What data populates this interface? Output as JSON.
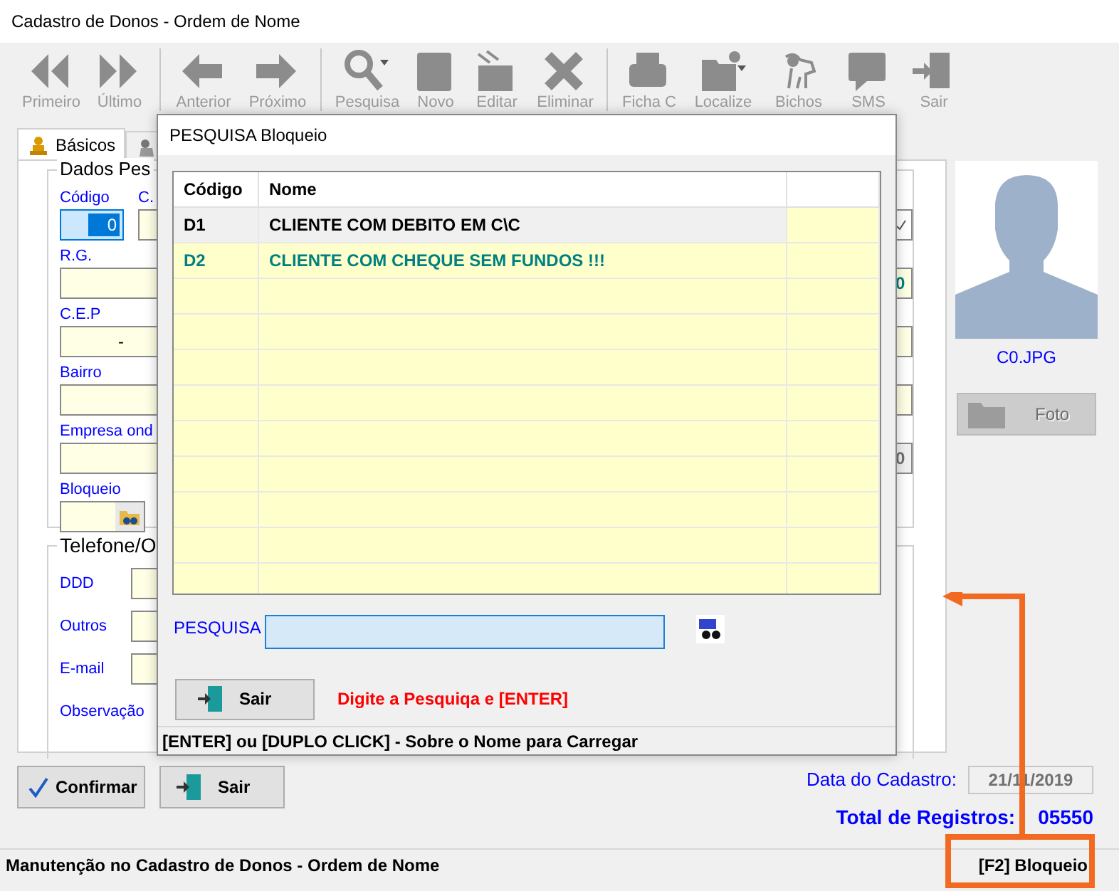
{
  "window": {
    "title": "Cadastro de Donos - Ordem de Nome"
  },
  "toolbar": [
    {
      "label": "Primeiro",
      "disabled": true
    },
    {
      "label": "Último",
      "disabled": true
    },
    {
      "label": "Anterior",
      "disabled": true
    },
    {
      "label": "Próximo",
      "disabled": true
    },
    {
      "label": "Pesquisa",
      "disabled": true
    },
    {
      "label": "Novo",
      "disabled": true
    },
    {
      "label": "Editar",
      "disabled": true
    },
    {
      "label": "Eliminar",
      "disabled": true
    },
    {
      "label": "Ficha C",
      "disabled": true
    },
    {
      "label": "Localize",
      "disabled": true
    },
    {
      "label": "Bichos",
      "disabled": true
    },
    {
      "label": "SMS",
      "disabled": true
    },
    {
      "label": "Sair",
      "disabled": true
    }
  ],
  "tabs": [
    {
      "label": "Básicos",
      "selected": true
    },
    {
      "selected": false
    }
  ],
  "form": {
    "group_1": "Dados Pes",
    "group_2": "Telefone/O",
    "fields": [
      {
        "label": "Código",
        "value": "0",
        "focused": true,
        "right": {
          "kind": "check"
        }
      },
      {
        "label": "R.G.",
        "right": {
          "kind": "value",
          "value": "0",
          "disabled": false
        }
      },
      {
        "label": "C.E.P",
        "value": "-",
        "right": {
          "kind": "empty"
        }
      },
      {
        "label": "Bairro",
        "right": {
          "kind": "empty"
        }
      },
      {
        "label": "Empresa ond",
        "right": {
          "kind": "value",
          "value": "0",
          "disabled": true
        }
      },
      {
        "label": "Bloqueio",
        "lookup": true
      }
    ],
    "second_label": "C.",
    "contacts": [
      {
        "label": "DDD",
        "field": true
      },
      {
        "label": "Outros",
        "field": true
      },
      {
        "label": "E-mail",
        "field": true
      },
      {
        "label": "Observação",
        "field": false
      }
    ]
  },
  "photo": {
    "caption": "C0.JPG",
    "button": {
      "label": "Foto",
      "disabled": true
    }
  },
  "buttons": [
    {
      "kind": "confirm",
      "label": "Confirmar"
    },
    {
      "kind": "exit",
      "label": "Sair"
    }
  ],
  "date": {
    "label": "Data do Cadastro:",
    "value": "21/11/2019"
  },
  "total": {
    "label": "Total de Registros:",
    "value": "05550"
  },
  "status_bar": {
    "text": "Manutenção no Cadastro de Donos - Ordem de Nome",
    "panel": "[F2] Bloqueio"
  },
  "dialog": {
    "title": "PESQUISA Bloqueio",
    "columns": [
      "Código",
      "Nome"
    ],
    "rows": [
      {
        "cells": [
          "D1",
          "CLIENTE COM DEBITO EM C\\C"
        ],
        "selected": true,
        "color": "#000000"
      },
      {
        "cells": [
          "D2",
          "CLIENTE COM CHEQUE SEM FUNDOS !!!"
        ],
        "selected": false,
        "color": "#008080"
      }
    ],
    "search": {
      "label": "PESQUISA"
    },
    "exit_button": "Sair",
    "hint": "Digite a Pesquiqa e [ENTER]",
    "status": "[ENTER] ou [DUPLO CLICK] - Sobre o Nome para Carregar"
  }
}
